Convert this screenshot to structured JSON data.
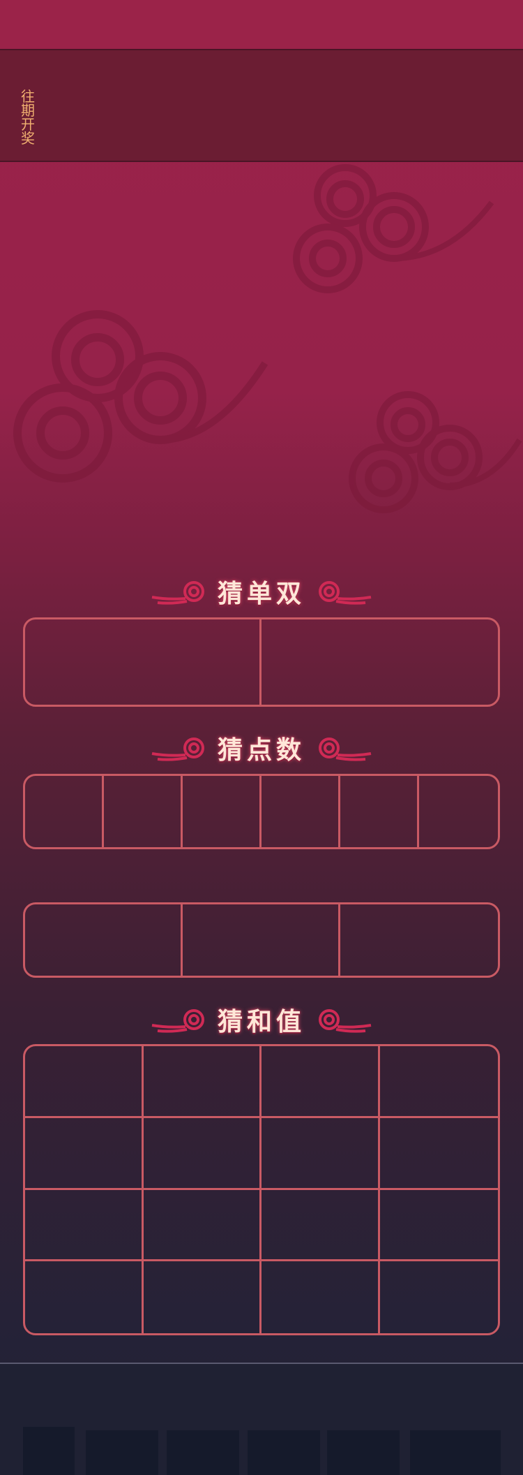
{
  "history": {
    "label": "往期开奖"
  },
  "sections": {
    "odd_even": {
      "title": "猜单双"
    },
    "points": {
      "title": "猜点数"
    },
    "sum": {
      "title": "猜和值"
    }
  },
  "colors": {
    "accent": "#9b2349",
    "cell_border": "#c95a64",
    "history_text": "#f0b070",
    "title_text": "#ffe7d8",
    "bottom_bar": "#1f2133"
  },
  "icons": [
    "cloud-icon",
    "swirl-left-icon",
    "swirl-right-icon"
  ]
}
